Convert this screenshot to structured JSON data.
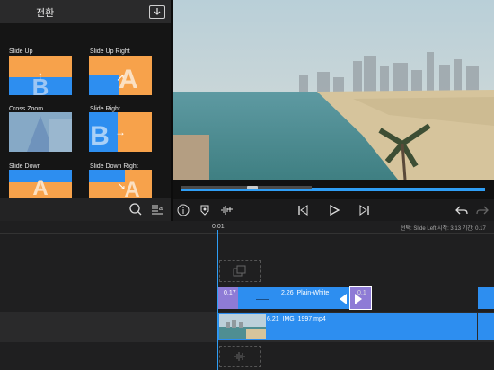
{
  "panel": {
    "title": "전환",
    "icons": {
      "import": "import-icon",
      "search": "search-icon",
      "sort": "sort-az-icon"
    }
  },
  "transitions": [
    {
      "label": "Slide Up",
      "glyph": "B",
      "arrow": "↑"
    },
    {
      "label": "Slide Up Right",
      "glyph": "A",
      "arrow": "↗"
    },
    {
      "label": "Cross Zoom",
      "glyph": "",
      "arrow": ""
    },
    {
      "label": "Slide Right",
      "glyph": "B",
      "arrow": "→"
    },
    {
      "label": "Slide Down",
      "glyph": "A",
      "arrow": "↓"
    },
    {
      "label": "Slide Down Right",
      "glyph": "A",
      "arrow": "↘"
    }
  ],
  "controls": {
    "icons": [
      "info-icon",
      "keyframe-icon",
      "audio-add-icon",
      "skip-back-icon",
      "play-icon",
      "skip-forward-icon",
      "undo-icon",
      "redo-icon"
    ]
  },
  "timeline": {
    "playhead_time": "0.01",
    "status": "선택: Slide Left 시작: 3.13 기간: 0.17",
    "title_clip": {
      "duration": "2.26",
      "name": "Plain-White"
    },
    "transition_clip": {
      "start": "0.17",
      "end": "0.1"
    },
    "video_clip": {
      "duration": "6.21",
      "name": "IMG_1997.mp4"
    }
  },
  "colors": {
    "accent": "#2f9ef5",
    "orange": "#f7a24b",
    "blue": "#2d8ef0",
    "purple": "#8e7bd6"
  }
}
